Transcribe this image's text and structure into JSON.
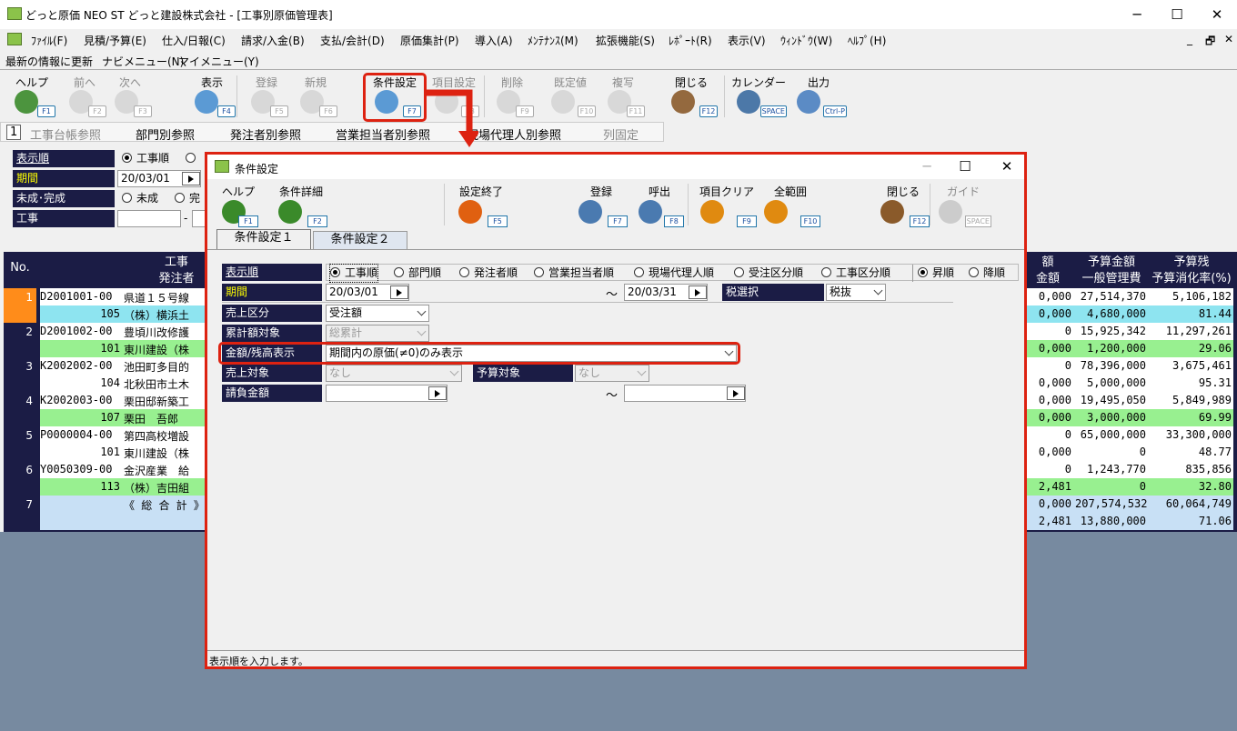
{
  "window": {
    "title": "どっと原価 NEO ST どっと建設株式会社 - [工事別原価管理表]",
    "minimize": "─",
    "maximize": "☐",
    "close": "✕"
  },
  "menu": [
    "ﾌｧｲﾙ(F)",
    "見積/予算(E)",
    "仕入/日報(C)",
    "請求/入金(B)",
    "支払/会計(D)",
    "原価集計(P)",
    "導入(A)",
    "ﾒﾝﾃﾅﾝｽ(M)",
    "拡張機能(S)",
    "ﾚﾎﾟｰﾄ(R)",
    "表示(V)",
    "ｳｨﾝﾄﾞｳ(W)",
    "ﾍﾙﾌﾟ(H)"
  ],
  "menu_right": [
    "_",
    "🗗",
    "✕"
  ],
  "infobar": [
    "最新の情報に更新",
    "ナビメニュー(N)",
    "マイメニュー(Y)"
  ],
  "toolbar": [
    {
      "label": "ヘルプ",
      "key": "F1",
      "icon": "help-icon",
      "disabled": false
    },
    {
      "label": "前へ",
      "key": "F2",
      "icon": "back-arrow-icon",
      "disabled": true
    },
    {
      "label": "次へ",
      "key": "F3",
      "icon": "forward-arrow-icon",
      "disabled": true
    },
    {
      "label": "表示",
      "key": "F4",
      "icon": "magnifier-icon",
      "disabled": false
    },
    {
      "label": "登録",
      "key": "F5",
      "icon": "register-icon",
      "disabled": true
    },
    {
      "label": "新規",
      "key": "F6",
      "icon": "new-document-icon",
      "disabled": true
    },
    {
      "label": "条件設定",
      "key": "F7",
      "icon": "condition-search-icon",
      "disabled": false
    },
    {
      "label": "項目設定",
      "key": "F8",
      "icon": "item-settings-icon",
      "disabled": true
    },
    {
      "label": "削除",
      "key": "F9",
      "icon": "trash-icon",
      "disabled": true
    },
    {
      "label": "既定値",
      "key": "F10",
      "icon": "refresh-icon",
      "disabled": true
    },
    {
      "label": "複写",
      "key": "F11",
      "icon": "copy-icon",
      "disabled": true
    },
    {
      "label": "閉じる",
      "key": "F12",
      "icon": "door-icon",
      "disabled": false
    },
    {
      "label": "カレンダー",
      "key": "SPACE",
      "icon": "calendar-icon",
      "disabled": false
    },
    {
      "label": "出力",
      "key": "Ctrl-P",
      "icon": "printer-icon",
      "disabled": false
    }
  ],
  "reftabs": [
    "1",
    "工事台帳参照",
    "部門別参照",
    "発注者別参照",
    "営業担当者別参照",
    "現場代理人別参照",
    "列固定"
  ],
  "back_conditions": {
    "labels": [
      "表示順",
      "期間",
      "未成･完成",
      "工事"
    ],
    "order_opt1": "工事順",
    "period_from": "20/03/01",
    "status_opt1": "未成",
    "status_opt2": "完",
    "dash": "-"
  },
  "grid": {
    "headers": {
      "no": "No.",
      "koji": "工事",
      "hacchusha": "発注者",
      "col_a": "額",
      "col_a2": "金額",
      "col_b": "予算金額",
      "col_b2": "一般管理費",
      "col_c": "予算残",
      "col_c2": "予算消化率(%)"
    },
    "rows": [
      {
        "no": "1",
        "code": "D2001001-00",
        "name": "県道１５号線",
        "sub_code": "105",
        "sub_name": "（株）横浜土",
        "a1": "0,000",
        "a2": "0,000",
        "b1": "27,514,370",
        "b2": "4,680,000",
        "c1": "5,106,182",
        "c2": "81.44",
        "color": "c"
      },
      {
        "no": "2",
        "code": "D2001002-00",
        "name": "豊頃川改修護",
        "sub_code": "101",
        "sub_name": "東川建設（株",
        "a1": "0",
        "a2": "0,000",
        "b1": "15,925,342",
        "b2": "1,200,000",
        "c1": "11,297,261",
        "c2": "29.06",
        "color": "g"
      },
      {
        "no": "3",
        "code": "K2002002-00",
        "name": "池田町多目的",
        "sub_code": "104",
        "sub_name": "北秋田市土木",
        "a1": "0",
        "a2": "0,000",
        "b1": "78,396,000",
        "b2": "5,000,000",
        "c1": "3,675,461",
        "c2": "95.31",
        "color": "w"
      },
      {
        "no": "4",
        "code": "K2002003-00",
        "name": "栗田邸新築工",
        "sub_code": "107",
        "sub_name": "栗田　吾郎",
        "a1": "0,000",
        "a2": "0,000",
        "b1": "19,495,050",
        "b2": "3,000,000",
        "c1": "5,849,989",
        "c2": "69.99",
        "color": "g"
      },
      {
        "no": "5",
        "code": "P0000004-00",
        "name": "第四高校増設",
        "sub_code": "101",
        "sub_name": "東川建設（株",
        "a1": "0",
        "a2": "0,000",
        "b1": "65,000,000",
        "b2": "0",
        "c1": "33,300,000",
        "c2": "48.77",
        "color": "w"
      },
      {
        "no": "6",
        "code": "Y0050309-00",
        "name": "金沢産業　給",
        "sub_code": "113",
        "sub_name": "（株）吉田組",
        "a1": "0",
        "a2": "2,481",
        "b1": "1,243,770",
        "b2": "0",
        "c1": "835,856",
        "c2": "32.80",
        "color": "g"
      },
      {
        "no": "7",
        "code": "",
        "name": "《 総 合 計 》",
        "sub_code": "",
        "sub_name": "",
        "a1": "0,000",
        "a2": "2,481",
        "b1": "207,574,532",
        "b2": "13,880,000",
        "c1": "60,064,749",
        "c2": "71.06",
        "color": "b"
      }
    ]
  },
  "dialog": {
    "title": "条件設定",
    "minimize": "─",
    "maximize": "☐",
    "close": "✕",
    "toolbar": [
      {
        "label": "ヘルプ",
        "key": "F1",
        "icon": "help-icon",
        "disabled": false
      },
      {
        "label": "条件詳細",
        "key": "F2",
        "icon": "help-icon",
        "disabled": false
      },
      {
        "label": "設定終了",
        "key": "F5",
        "icon": "ok-icon",
        "disabled": false
      },
      {
        "label": "登録",
        "key": "F7",
        "icon": "register-icon",
        "disabled": false
      },
      {
        "label": "呼出",
        "key": "F8",
        "icon": "recall-icon",
        "disabled": false
      },
      {
        "label": "項目クリア",
        "key": "F9",
        "icon": "clear-icon",
        "disabled": false
      },
      {
        "label": "全範囲",
        "key": "F10",
        "icon": "full-range-icon",
        "disabled": false
      },
      {
        "label": "閉じる",
        "key": "F12",
        "icon": "door-icon",
        "disabled": false
      },
      {
        "label": "ガイド",
        "key": "SPACE",
        "icon": "guide-bulb-icon",
        "disabled": true
      }
    ],
    "tabs": [
      "条件設定１",
      "条件設定２"
    ],
    "fields": {
      "order_label": "表示順",
      "order_options": [
        "工事順",
        "部門順",
        "発注者順",
        "営業担当者順",
        "現場代理人順",
        "受注区分順",
        "工事区分順"
      ],
      "sort_options": [
        "昇順",
        "降順"
      ],
      "period_label": "期間",
      "period_from": "20/03/01",
      "tilde": "～",
      "period_to": "20/03/31",
      "tax_label": "税選択",
      "tax_value": "税抜",
      "sales_kind_label": "売上区分",
      "sales_kind_value": "受注額",
      "cumulative_label": "累計額対象",
      "cumulative_value": "総累計",
      "amount_label": "金額/残高表示",
      "amount_value": "期間内の原価(≠0)のみ表示",
      "sales_target_label": "売上対象",
      "sales_target_value": "なし",
      "budget_target_label": "予算対象",
      "budget_target_value": "なし",
      "contract_label": "請負金額"
    },
    "status": "表示順を入力します。"
  },
  "colors": {
    "navy": "#1b1c45",
    "highlight_red": "#d21",
    "cyan_row": "#8ee4f0",
    "green_row": "#98f090",
    "total_row": "#c8e0f5",
    "bottom": "#778aa0"
  }
}
